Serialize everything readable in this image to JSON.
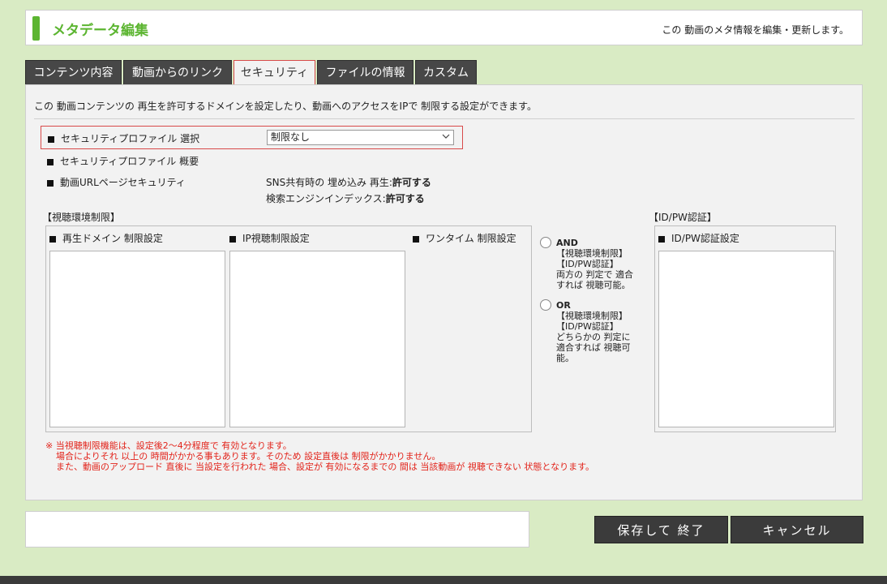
{
  "header": {
    "title": "メタデータ編集",
    "description": "この 動画のメタ情報を編集・更新します。"
  },
  "tabs": [
    {
      "label": "コンテンツ内容"
    },
    {
      "label": "動画からのリンク"
    },
    {
      "label": "セキュリティ",
      "active": true
    },
    {
      "label": "ファイルの情報"
    },
    {
      "label": "カスタム"
    }
  ],
  "panel": {
    "intro": "この 動画コンテンツの 再生を許可するドメインを設定したり、動画へのアクセスをIPで 制限する設定ができます。",
    "profile_select_label": "セキュリティプロファイル 選択",
    "profile_select_value": "制限なし",
    "profile_summary_label": "セキュリティプロファイル 概要",
    "url_security_label": "動画URLページセキュリティ",
    "sns_embed_label": "SNS共有時の 埋め込み 再生:",
    "sns_embed_value": "許可する",
    "search_index_label": "検索エンジンインデックス:",
    "search_index_value": "許可する"
  },
  "viewing_env": {
    "section_title": "【視聴環境制限】",
    "domain_label": "再生ドメイン 制限設定",
    "ip_label": "IP視聴制限設定",
    "onetime_label": "ワンタイム 制限設定"
  },
  "combine": {
    "and_title": "AND",
    "and_lines": [
      "【視聴環境制限】",
      "【ID/PW認証】",
      "両方の 判定で 適合",
      "すれば 視聴可能。"
    ],
    "or_title": "OR",
    "or_lines": [
      "【視聴環境制限】",
      "【ID/PW認証】",
      "どちらかの 判定に",
      "適合すれば 視聴可",
      "能。"
    ]
  },
  "idpw": {
    "section_title": "【ID/PW認証】",
    "settings_label": "ID/PW認証設定"
  },
  "notes": [
    "※ 当視聴制限機能は、設定後2～4分程度で 有効となります。",
    "場合によりそれ 以上の 時間がかかる事もあります。そのため 設定直後は 制限がかかりません。",
    "また、動画のアップロード 直後に 当設定を行われた 場合、設定が 有効になるまでの 間は 当該動画が 視聴できない 状態となります。"
  ],
  "buttons": {
    "save_label": "保存して 終了",
    "cancel_label": "キャンセル"
  },
  "colors": {
    "background": "#d9ebc4",
    "accent": "#5cb531",
    "tab_dark": "#474747",
    "highlight_border": "#d84a4a",
    "note_red": "#e2231a"
  }
}
